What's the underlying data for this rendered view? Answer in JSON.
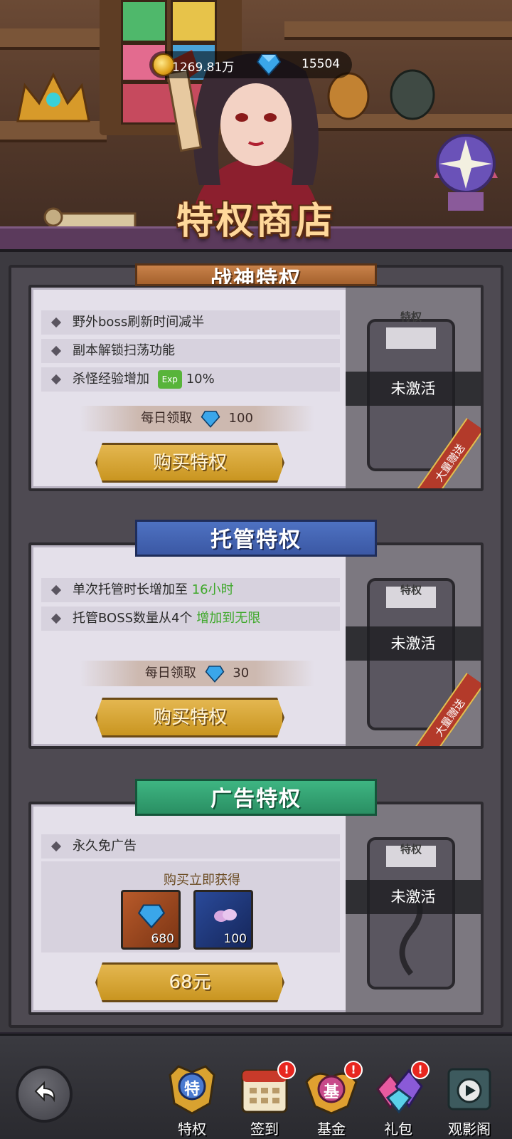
{
  "header": {
    "gold": "1269.81万",
    "gems": "15504",
    "title": "特权商店"
  },
  "cards": [
    {
      "title": "战神特权",
      "features": [
        {
          "text": "野外boss刷新时间减半"
        },
        {
          "text": "副本解锁扫荡功能"
        },
        {
          "text": "杀怪经验增加",
          "highlight": "10%"
        }
      ],
      "daily_label": "每日领取",
      "daily_amount": "100",
      "button": "购买特权",
      "emblem_label": "特权",
      "status": "未激活",
      "ribbon": "大量赠送"
    },
    {
      "title": "托管特权",
      "features": [
        {
          "text": "单次托管时长增加至 ",
          "highlight": "16小时"
        },
        {
          "text": "托管BOSS数量从4个 ",
          "highlight": "增加到无限"
        }
      ],
      "daily_label": "每日领取",
      "daily_amount": "30",
      "button": "购买特权",
      "emblem_label": "特权",
      "status": "未激活",
      "ribbon": "大量赠送"
    },
    {
      "title": "广告特权",
      "features": [
        {
          "text": "永久免广告"
        }
      ],
      "reward_label": "购买立即获得",
      "rewards": [
        {
          "icon": "gem-icon",
          "qty": "680"
        },
        {
          "icon": "crystal-icon",
          "qty": "100"
        }
      ],
      "button": "68元",
      "emblem_label": "特权",
      "status": "未激活"
    }
  ],
  "exp_badge": "Exp",
  "nav": [
    {
      "label": "特权",
      "icon_text": "特",
      "badge": ""
    },
    {
      "label": "签到",
      "icon_text": "",
      "badge": "!"
    },
    {
      "label": "基金",
      "icon_text": "基",
      "badge": "!"
    },
    {
      "label": "礼包",
      "icon_text": "",
      "badge": "!"
    },
    {
      "label": "观影阁",
      "icon_text": "",
      "badge": ""
    }
  ],
  "colors": {
    "gem": "#3aa6ea",
    "gold": "#e0a21c",
    "button": "#d4a434",
    "banner_blue": "#3b58a4",
    "banner_green": "#2a8f63",
    "highlight_green": "#3ea82a"
  }
}
